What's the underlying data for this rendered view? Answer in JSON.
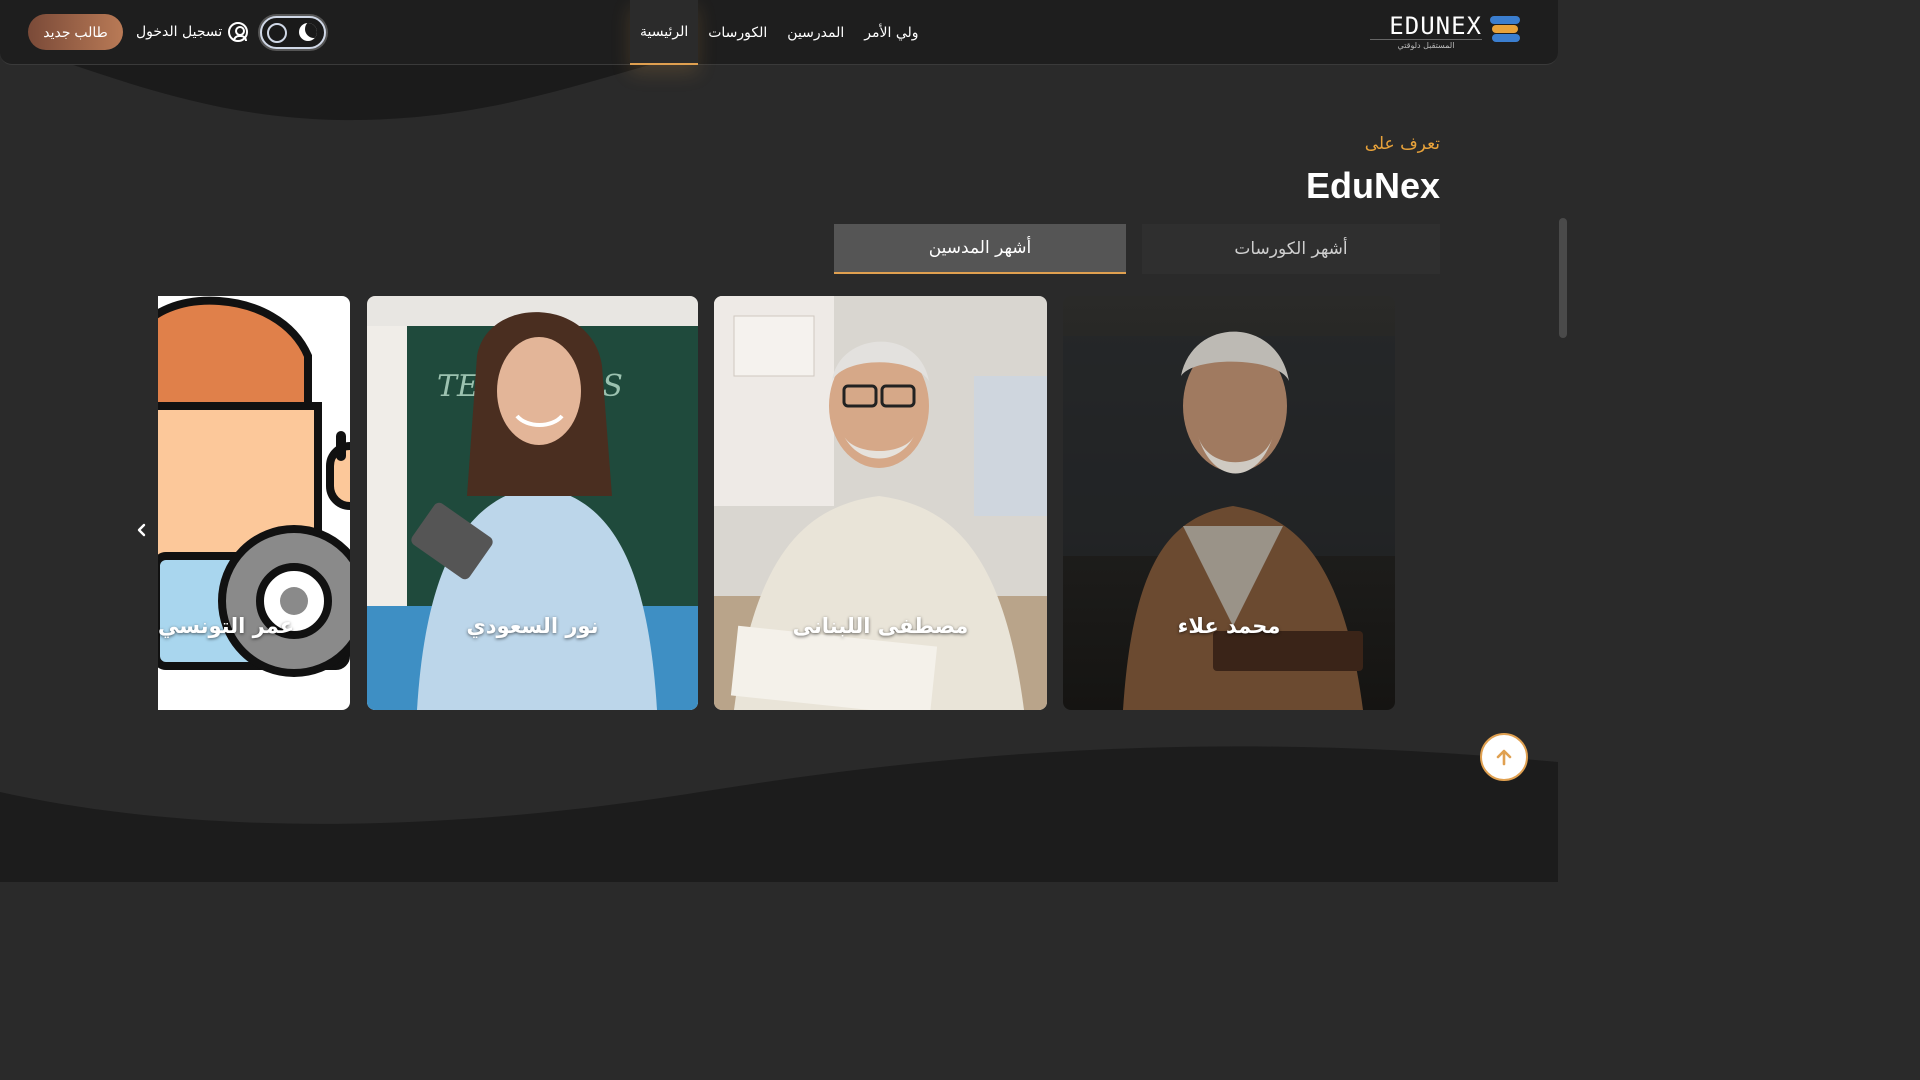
{
  "header": {
    "brand_name": "EDUNEX",
    "brand_tagline": "المستقبل دلوقتي",
    "nav": [
      {
        "label": "الرئيسية",
        "active": true
      },
      {
        "label": "الكورسات",
        "active": false
      },
      {
        "label": "المدرسين",
        "active": false
      },
      {
        "label": "ولي الأمر",
        "active": false
      }
    ],
    "login_label": "تسجيل الدخول",
    "new_student_label": "طالب جديد",
    "theme_mode": "dark"
  },
  "section": {
    "eyebrow": "تعرف على",
    "title": "EduNex",
    "tabs": [
      {
        "label": "أشهر الكورسات",
        "active": false
      },
      {
        "label": "أشهر المدسين",
        "active": true
      }
    ]
  },
  "teachers": [
    {
      "name": "محمد علاء"
    },
    {
      "name": "مصطفى اللبنانى"
    },
    {
      "name": "نور السعودي"
    },
    {
      "name": "عمر التونسي"
    }
  ],
  "colors": {
    "accent": "#e8a23a",
    "background": "#2a2a2a",
    "header_bg": "#1e1e1e",
    "brand_blue": "#3b7ecf"
  },
  "icons": {
    "user": "user-circle-icon",
    "moon": "moon-icon",
    "prev": "chevron-left-icon",
    "scroll_top": "arrow-up-icon"
  }
}
